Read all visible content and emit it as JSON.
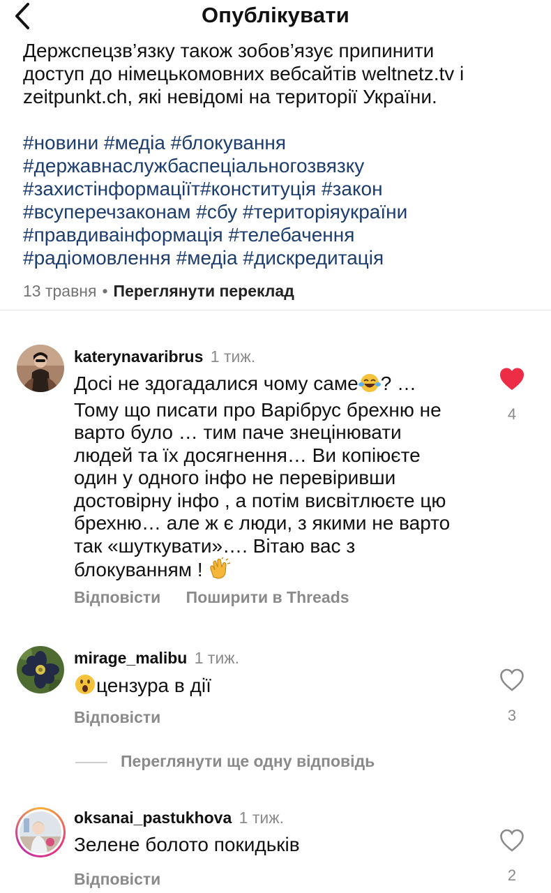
{
  "header": {
    "title": "Опублікувати"
  },
  "caption": {
    "lines": [
      "Держспецзв’язку також зобов’язує припинити",
      "доступ до німецькомовних вебсайтів weltnetz.tv і",
      "zeitpunkt.ch, які невідомі на території України."
    ],
    "hashtag_lines": [
      "#новини #медіа #блокування",
      "#державнаслужбаспеціальногозвязку",
      "#захистінформаціїт#конституція #закон",
      "#всуперечзаконам #сбу #територіяукраїни",
      "#правдиваінформація #телебачення",
      "#радіомовлення #медіа #дискредитація"
    ],
    "date": "13 травня",
    "separator": "•",
    "translate_label": "Переглянути переклад"
  },
  "comments": [
    {
      "username": "katerynavaribrus",
      "time": "1 тиж.",
      "text_lines": [
        "Досі не здогадалися чому саме",
        "? …",
        "Тому що писати про Варібрус брехню не",
        "варто було … тим паче знецінювати",
        "людей та їх досягнення… Ви копіюєте",
        "один у одного інфо не перевіривши",
        "достовірну інфо , а потім висвітлюєте цю",
        "брехню… але ж є люди, з якими не варто",
        "так «шуткувати»…. Вітаю вас з",
        "блокуванням !"
      ],
      "reply_label": "Відповісти",
      "share_label": "Поширити в Threads",
      "likes": "4",
      "liked": true
    },
    {
      "username": "mirage_malibu",
      "time": "1 тиж.",
      "text": "цензура в дії",
      "reply_label": "Відповісти",
      "likes": "3",
      "liked": false
    },
    {
      "username": "oksanai_pastukhova",
      "time": "1 тиж.",
      "text": "Зелене болото покидьків",
      "reply_label": "Відповісти",
      "likes": "2",
      "liked": false
    }
  ],
  "more_replies_label": "Переглянути ще одну відповідь",
  "colors": {
    "hashtag": "#1d3d6e",
    "like_red": "#ed2d45",
    "secondary_text": "#8a8a8a"
  },
  "icons": [
    "back-chevron-icon",
    "heart-filled-icon",
    "heart-outline-icon",
    "laughing-tears-emoji",
    "clapping-hands-emoji",
    "surprised-face-emoji"
  ]
}
